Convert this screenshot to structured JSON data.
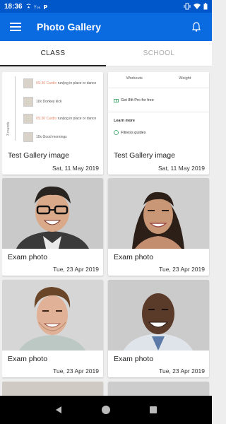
{
  "status": {
    "time": "18:36",
    "left_icons": [
      "wifi-calling-icon",
      "data-icon",
      "parking-icon"
    ],
    "right_icons": [
      "vibrate-icon",
      "wifi-icon",
      "battery-icon"
    ]
  },
  "app_bar": {
    "title": "Photo Gallery"
  },
  "tabs": [
    {
      "label": "CLASS",
      "active": true
    },
    {
      "label": "SCHOOL",
      "active": false
    }
  ],
  "workout_card": {
    "rounds_label": "3 rounds",
    "rows": [
      {
        "name": "0S:30 Cardio",
        "note": "run/jog in place or dance"
      },
      {
        "name": "10x Donkey kick",
        "note": ""
      },
      {
        "name": "0S:30 Cardio",
        "note": "run/jog in place or dance"
      },
      {
        "name": "10x Good mornings",
        "note": ""
      }
    ]
  },
  "app_card": {
    "tabs": [
      "Workouts",
      "Weight"
    ],
    "promo": "Get 8fit Pro for free",
    "learn_more": "Learn more",
    "guide": "Fitness guides"
  },
  "cards": [
    {
      "title": "Test Gallery image",
      "date": "Sat, 11 May 2019"
    },
    {
      "title": "Test Gallery image",
      "date": "Sat, 11 May 2019"
    },
    {
      "title": "Exam photo",
      "date": "Tue, 23 Apr 2019"
    },
    {
      "title": "Exam photo",
      "date": "Tue, 23 Apr 2019"
    },
    {
      "title": "Exam photo",
      "date": "Tue, 23 Apr 2019"
    },
    {
      "title": "Exam photo",
      "date": "Tue, 23 Apr 2019"
    }
  ],
  "colors": {
    "app_bar": "#0a6be0",
    "status_bar": "#0057c9",
    "background": "#eeeeee",
    "nav_bar": "#000000"
  }
}
